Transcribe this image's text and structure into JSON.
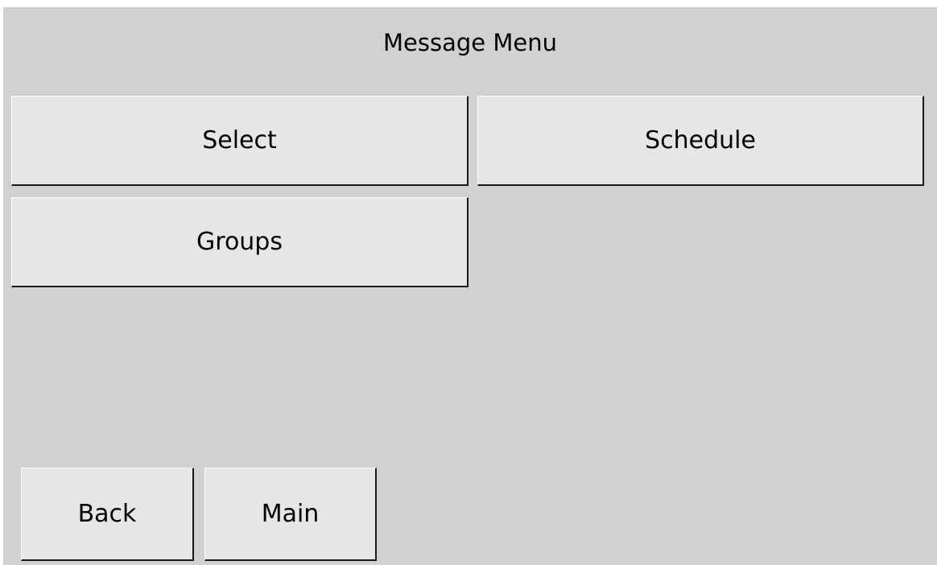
{
  "header": {
    "title": "Message Menu"
  },
  "menu": {
    "select_label": "Select",
    "schedule_label": "Schedule",
    "groups_label": "Groups"
  },
  "footer": {
    "back_label": "Back",
    "main_label": "Main"
  },
  "colors": {
    "background": "#d1d1d1",
    "button_face": "#e6e6e6",
    "text": "#000000"
  }
}
